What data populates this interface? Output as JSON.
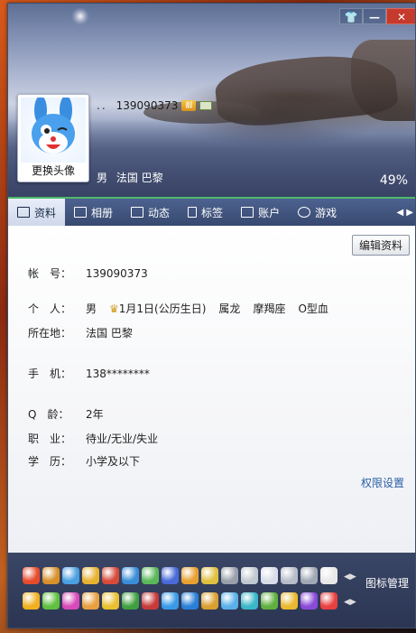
{
  "window": {
    "skin_icon": "tshirt-icon",
    "minimize_icon": "minimize-icon",
    "close_icon": "close-icon"
  },
  "profile": {
    "nick_placeholder": "..",
    "qq_number": "139090373",
    "avatar_button": "更换头像",
    "gender": "男",
    "location": "法国 巴黎",
    "completion": "49%"
  },
  "tabs": [
    {
      "label": "资料",
      "icon": "profile-card-icon",
      "active": true
    },
    {
      "label": "相册",
      "icon": "photo-album-icon"
    },
    {
      "label": "动态",
      "icon": "feed-list-icon"
    },
    {
      "label": "标签",
      "icon": "bookmark-icon"
    },
    {
      "label": "账户",
      "icon": "wallet-icon"
    },
    {
      "label": "游戏",
      "icon": "game-icon"
    }
  ],
  "details": {
    "edit_button": "编辑资料",
    "account_label": "帐　号：",
    "account_value": "139090373",
    "personal_label": "个　人：",
    "personal_gender": "男",
    "birthday": "1月1日(公历生日)",
    "zodiac": "属龙",
    "constellation": "摩羯座",
    "blood": "O型血",
    "location_label": "所在地：",
    "location_value": "法国 巴黎",
    "phone_label": "手　机：",
    "phone_value": "138********",
    "qage_label": "Q　龄：",
    "qage_value": "2年",
    "job_label": "职　业：",
    "job_value": "待业/无业/失业",
    "edu_label": "学　历：",
    "edu_value": "小学及以下",
    "permission_link": "权限设置"
  },
  "iconbar": {
    "manage_label": "图标管理",
    "row1_colors": [
      "#e84b2c",
      "#d8912a",
      "#4aa0e0",
      "#e8b230",
      "#d84a3a",
      "#3a8ed8",
      "#5ab85a",
      "#4a6ad8",
      "#e8a030",
      "#e0c040",
      "#9aa0aa",
      "#c0c8d0",
      "#d8dce8",
      "#b8bcc8",
      "#a0a8b4",
      "#e8e8e8"
    ],
    "row2_colors": [
      "#f0b020",
      "#60c040",
      "#d84ab8",
      "#e8a040",
      "#e8c030",
      "#40a040",
      "#c83a3a",
      "#3a9ae8",
      "#2a80d8",
      "#d8a030",
      "#5ab0e8",
      "#3ab8c8",
      "#60b040",
      "#e8b830",
      "#8a4ad8",
      "#e84040"
    ]
  }
}
